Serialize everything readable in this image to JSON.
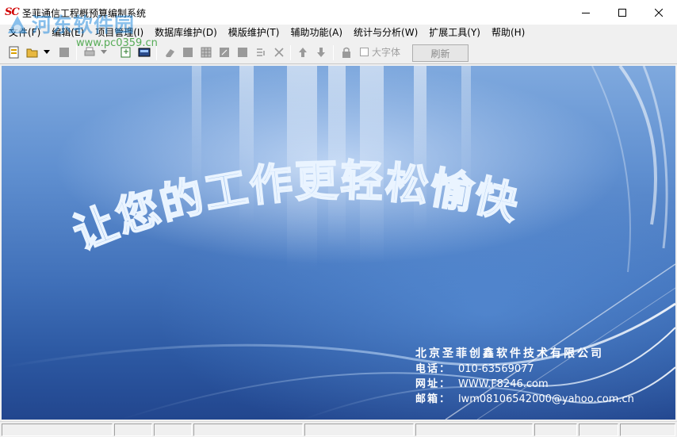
{
  "window": {
    "logo_text": "SC",
    "title": "圣菲通信工程概预算编制系统",
    "controls": {
      "minimize": "minimize-icon",
      "maximize": "maximize-icon",
      "close": "close-icon"
    }
  },
  "watermark": {
    "text": "河东软件园",
    "url": "www.pc0359.cn"
  },
  "menu": {
    "items": [
      {
        "label": "文件(F)"
      },
      {
        "label": "编辑(E)"
      },
      {
        "label": "项目管理(I)"
      },
      {
        "label": "数据库维护(D)"
      },
      {
        "label": "模版维护(T)"
      },
      {
        "label": "辅助功能(A)"
      },
      {
        "label": "统计与分析(W)"
      },
      {
        "label": "扩展工具(Y)"
      },
      {
        "label": "帮助(H)"
      }
    ]
  },
  "toolbar": {
    "big_font_label": "大字体",
    "refresh_label": "刷新"
  },
  "main": {
    "slogan": "让您的工作更轻松愉快",
    "company": {
      "name": "北京圣菲创鑫软件技术有限公司",
      "phone_label": "电话：",
      "phone": "010-63569077",
      "site_label": "网址：",
      "site": "WWW.F8246.com",
      "email_label": "邮箱：",
      "email": "lwm08106542000@yahoo.com.cn"
    }
  },
  "colors": {
    "logo_red": "#d00000",
    "background_blue": "#3f6fb8",
    "text_white": "#ffffff"
  }
}
